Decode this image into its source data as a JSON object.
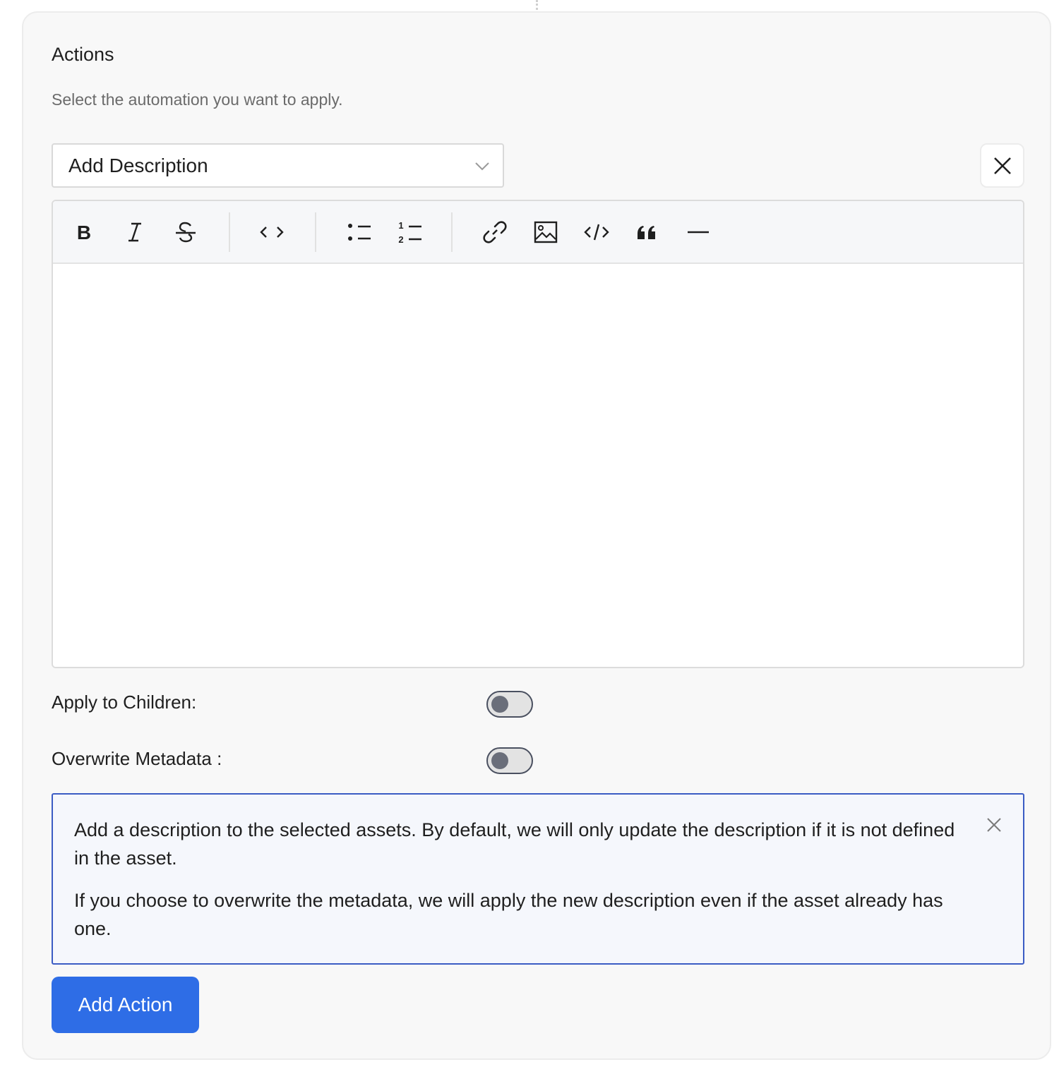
{
  "actions": {
    "title": "Actions",
    "subtitle": "Select the automation you want to apply.",
    "select": {
      "value": "Add Description",
      "icon": "chevron-down-icon"
    },
    "remove_icon": "close-icon",
    "toolbar": {
      "groups": [
        [
          "bold-icon",
          "italic-icon",
          "strikethrough-icon"
        ],
        [
          "inline-code-icon"
        ],
        [
          "bullet-list-icon",
          "ordered-list-icon"
        ],
        [
          "link-icon",
          "image-icon",
          "code-block-icon",
          "quote-icon",
          "horizontal-rule-icon"
        ]
      ]
    },
    "editor_content": "",
    "apply_children": {
      "label": "Apply to Children:",
      "enabled": false
    },
    "overwrite_metadata": {
      "label": "Overwrite Metadata :",
      "enabled": false
    },
    "info": {
      "paragraph_1": "Add a description to the selected assets. By default, we will only update the description if it is not defined in the asset.",
      "paragraph_2": "If you choose to overwrite the metadata, we will apply the new description even if the asset already has one."
    },
    "add_action_label": "Add Action"
  },
  "colors": {
    "primary": "#2e6de6",
    "info_border": "#3b5cc4",
    "card_bg": "#f8f8f8"
  }
}
